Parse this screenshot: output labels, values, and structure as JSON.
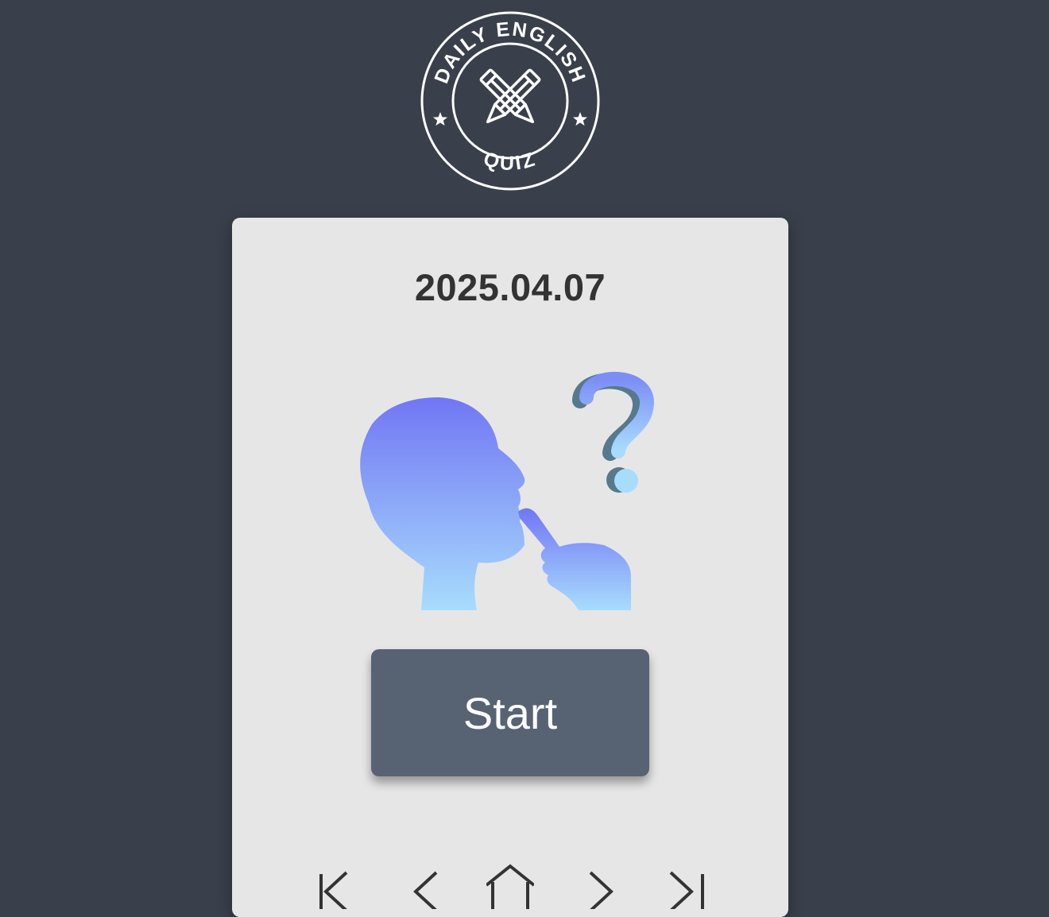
{
  "logo": {
    "top_text": "DAILY ENGLISH",
    "bottom_text": "QUIZ",
    "icon": "crossed-pencils-icon"
  },
  "quiz": {
    "date": "2025.04.07",
    "illustration": "thinking-person-question-mark",
    "start_label": "Start"
  },
  "nav": {
    "icons": [
      "first-icon",
      "previous-icon",
      "home-icon",
      "next-icon",
      "last-icon"
    ]
  },
  "colors": {
    "background": "#3a404b",
    "card": "#e7e6e7",
    "button": "#576373",
    "button_text": "#ffffff",
    "date_text": "#333333",
    "gradient_top": "#7176f4",
    "gradient_bottom": "#a8dcfd"
  }
}
